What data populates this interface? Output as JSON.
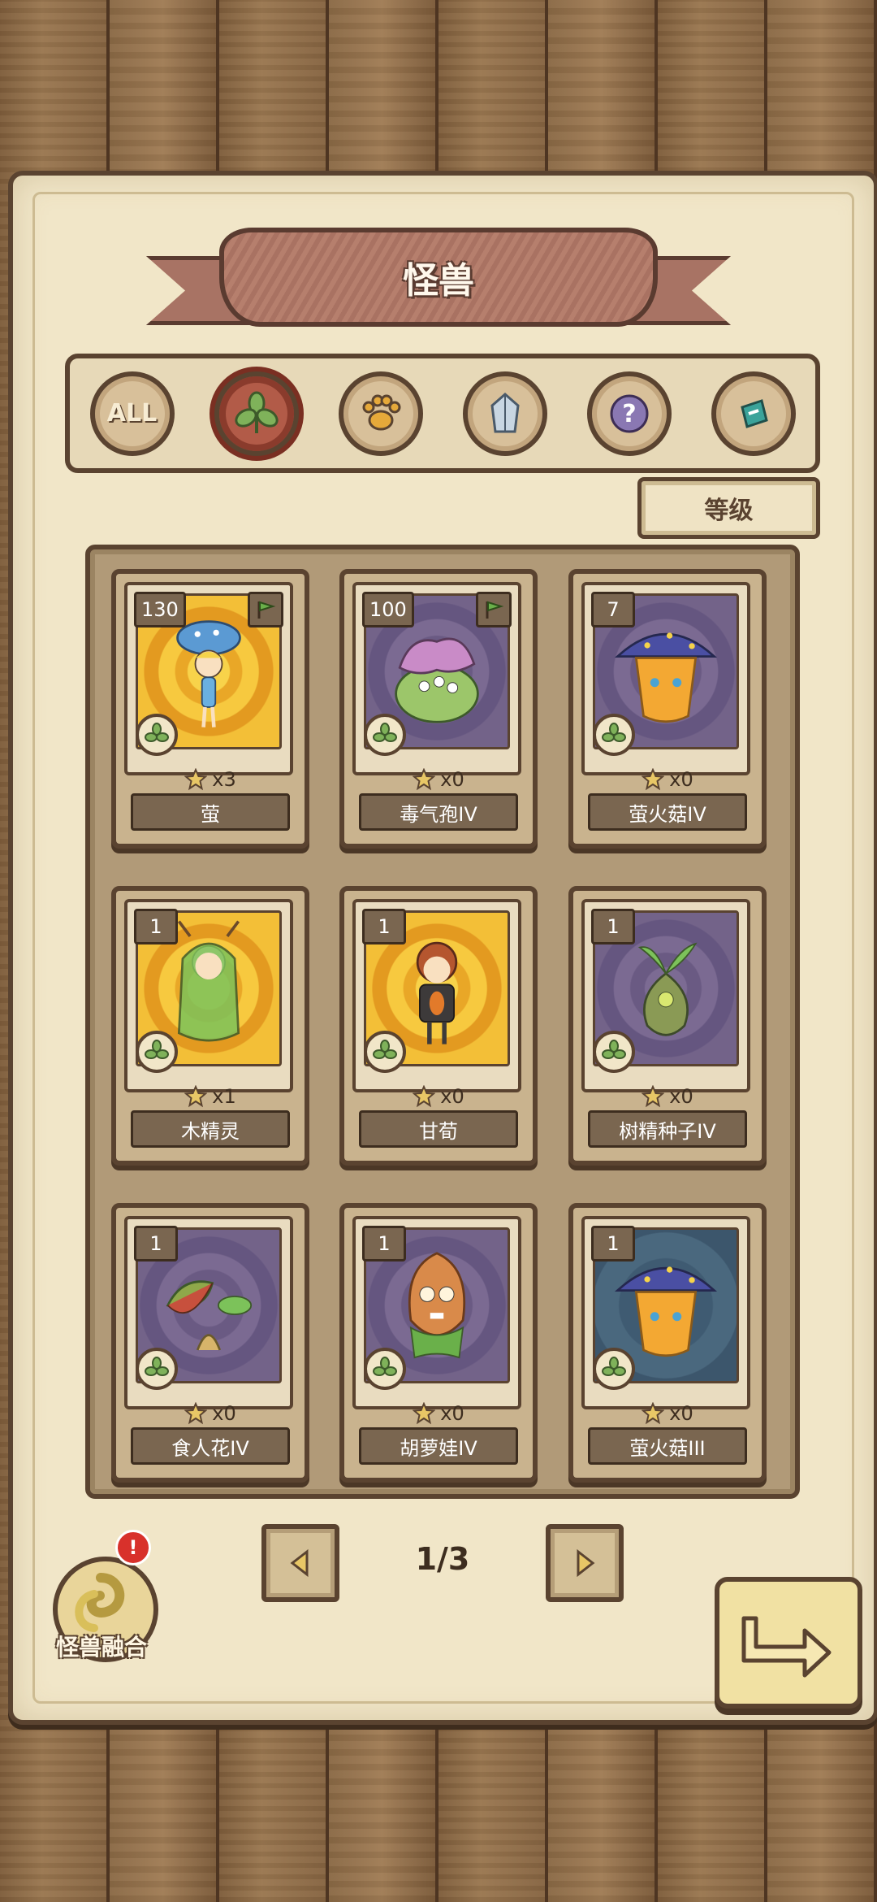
{
  "title": "怪兽",
  "filters": [
    {
      "id": "all",
      "label": "ALL",
      "icon": "all-text-icon",
      "active": false
    },
    {
      "id": "plant",
      "label": "",
      "icon": "leaf-icon",
      "active": true
    },
    {
      "id": "beast",
      "label": "",
      "icon": "paw-icon",
      "active": false
    },
    {
      "id": "crystal",
      "label": "",
      "icon": "crystal-icon",
      "active": false
    },
    {
      "id": "unknown",
      "label": "",
      "icon": "question-icon",
      "active": false
    },
    {
      "id": "special",
      "label": "",
      "icon": "hook-icon",
      "active": false
    }
  ],
  "sort_label": "等级",
  "cards": [
    {
      "count": "130",
      "name": "萤",
      "stars": "x3",
      "bg": "gold",
      "flag": true,
      "creature": "mushroom-fairy"
    },
    {
      "count": "100",
      "name": "毒气孢IV",
      "stars": "x0",
      "bg": "purple",
      "flag": true,
      "creature": "spore-blob"
    },
    {
      "count": "7",
      "name": "萤火菇IV",
      "stars": "x0",
      "bg": "purple",
      "flag": false,
      "creature": "firefly-mushroom"
    },
    {
      "count": "1",
      "name": "木精灵",
      "stars": "x1",
      "bg": "gold",
      "flag": false,
      "creature": "wood-elf"
    },
    {
      "count": "1",
      "name": "甘荀",
      "stars": "x0",
      "bg": "gold",
      "flag": false,
      "creature": "carrot-girl"
    },
    {
      "count": "1",
      "name": "树精种子IV",
      "stars": "x0",
      "bg": "purple",
      "flag": false,
      "creature": "tree-seed"
    },
    {
      "count": "1",
      "name": "食人花IV",
      "stars": "x0",
      "bg": "purple",
      "flag": false,
      "creature": "flytrap"
    },
    {
      "count": "1",
      "name": "胡萝娃IV",
      "stars": "x0",
      "bg": "purple",
      "flag": false,
      "creature": "carrot-doll"
    },
    {
      "count": "1",
      "name": "萤火菇III",
      "stars": "x0",
      "bg": "blue",
      "flag": false,
      "creature": "firefly-mushroom"
    }
  ],
  "pagination": {
    "text": "1/3"
  },
  "fusion": {
    "label": "怪兽融合",
    "alert": "!"
  },
  "colors": {
    "frame": "#5a4330",
    "active_filter": "#b25b48",
    "paper": "#f1e6c8"
  }
}
